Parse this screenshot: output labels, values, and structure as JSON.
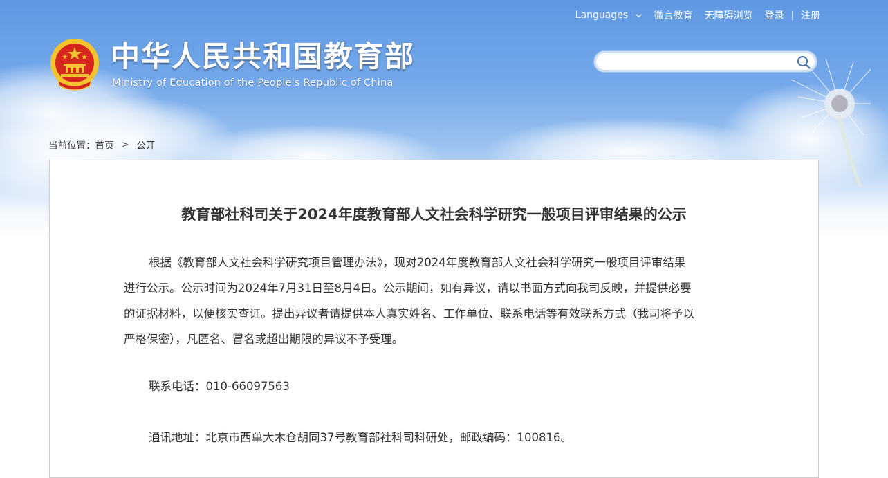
{
  "header": {
    "top_links": {
      "languages": "Languages",
      "weibo": "微言教育",
      "accessibility": "无障碍浏览",
      "login": "登录",
      "separator": "|",
      "register": "注册"
    },
    "site_title_cn": "中华人民共和国教育部",
    "site_title_en": "Ministry of Education of the People's Republic of China",
    "search": {
      "value": "",
      "placeholder": ""
    }
  },
  "breadcrumb": {
    "prefix": "当前位置：",
    "home": "首页",
    "arrow": ">",
    "current": "公开"
  },
  "article": {
    "title": "教育部社科司关于2024年度教育部人文社会科学研究一般项目评审结果的公示",
    "paragraph_lines": [
      "根据《教育部人文社会科学研究项目管理办法》，现对2024年度教育部人文社会科学研究一般项目评审结果",
      "进行公示。公示时间为2024年7月31日至8月4日。公示期间，如有异议，请以书面方式向我司反映，并提供必要",
      "的证据材料，以便核实查证。提出异议者请提供本人真实姓名、工作单位、联系电话等有效联系方式（我司将予以",
      "严格保密），凡匿名、冒名或超出期限的异议不予受理。"
    ],
    "phone": "联系电话：010-66097563",
    "address": "通讯地址：北京市西单大木仓胡同37号教育部社科司科研处，邮政编码：100816。"
  },
  "colors": {
    "header_blue": "#5f98e2",
    "text": "#333333",
    "emblem_red": "#d7261e",
    "emblem_gold": "#f4c430"
  },
  "icons": {
    "emblem": "national-emblem-icon",
    "search": "search-icon",
    "languages_dropdown": "chevron-down-icon"
  }
}
